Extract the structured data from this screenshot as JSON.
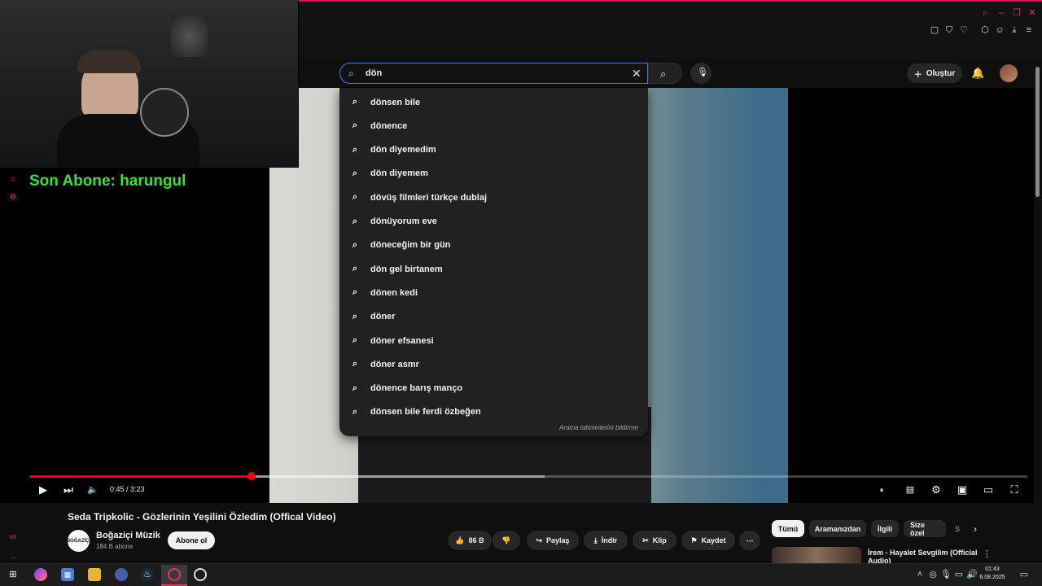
{
  "search": {
    "query": "dön",
    "suggestions": [
      "dönsen bile",
      "dönence",
      "dön diyemedim",
      "dön diyemem",
      "dövüş filmleri türkçe dublaj",
      "dönüyorum eve",
      "döneceğim bir gün",
      "dön gel birtanem",
      "dönen kedi",
      "döner",
      "döner efsanesi",
      "döner asmr",
      "dönence barış manço",
      "dönsen bile ferdi özbeğen"
    ],
    "report_label": "Arama tahminlerini bildirme"
  },
  "header": {
    "create_label": "Oluştur"
  },
  "overlay": {
    "last_subscriber": "Son Abone: harungul"
  },
  "player": {
    "time": "0:45 / 3:23",
    "progress": 0.222,
    "buffered": 0.516
  },
  "video": {
    "title": "Seda Tripkolic - Gözlerinin Yeşilini Özledim (Offical Video)",
    "channel_name": "Boğaziçi Müzik",
    "channel_logo": "BOĞAZİÇİ",
    "channel_subs": "184 B abone",
    "subscribe_label": "Abone ol",
    "like_count": "86 B",
    "share_label": "Paylaş",
    "download_label": "İndir",
    "clip_label": "Klip",
    "save_label": "Kaydet"
  },
  "chips": [
    "Tümü",
    "Aramanızdan",
    "İlgili",
    "Size özel",
    "S"
  ],
  "recommendation": {
    "title": "İrem - Hayalet Sevgilim (Official Audio)"
  },
  "taskbar": {
    "time": "01:43",
    "date": "6.08.2025"
  },
  "colors": {
    "accent": "#ff0000",
    "overlay_text": "#39e03a",
    "browser_accent": "#d3184e"
  }
}
